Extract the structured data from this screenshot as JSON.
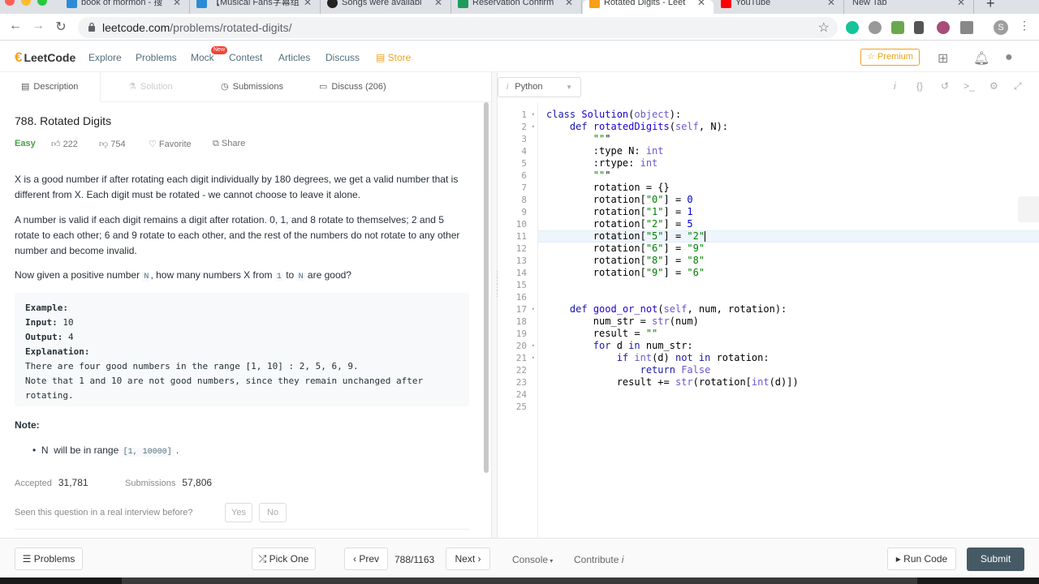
{
  "browser": {
    "tabs": [
      {
        "label": "book of mormon - 搜",
        "color": "#2c8bd6"
      },
      {
        "label": "【Musical Fans字幕组",
        "color": "#2c8bd6"
      },
      {
        "label": "Songs were availabl",
        "color": "#222222"
      },
      {
        "label": "Reservation Confirm",
        "color": "#1e9b5c"
      },
      {
        "label": "Rotated Digits - Leet",
        "color": "#f89f1b"
      },
      {
        "label": "YouTube",
        "color": "#ff0000"
      },
      {
        "label": "New Tab",
        "color": "#dee1e6"
      }
    ],
    "url_host": "leetcode.com",
    "url_path": "/problems/rotated-digits/",
    "profile_initial": "S"
  },
  "nav": {
    "logo": "LeetCode",
    "links": [
      "Explore",
      "Problems",
      "Mock",
      "Contest",
      "Articles",
      "Discuss"
    ],
    "store": "Store",
    "new_badge": "New",
    "premium": "Premium"
  },
  "left_tabs": [
    "Description",
    "Solution",
    "Submissions",
    "Discuss (206)"
  ],
  "problem": {
    "title": "788. Rotated Digits",
    "difficulty": "Easy",
    "likes": "222",
    "dislikes": "754",
    "favorite": "Favorite",
    "share": "Share",
    "p1": "X is a good number if after rotating each digit individually by 180 degrees, we get a valid number that is different from X.  Each digit must be rotated - we cannot choose to leave it alone.",
    "p2": "A number is valid if each digit remains a digit after rotation. 0, 1, and 8 rotate to themselves; 2 and 5 rotate to each other; 6 and 9 rotate to each other, and the rest of the numbers do not rotate to any other number and become invalid.",
    "p3_a": "Now given a positive number",
    "p3_n1": "N",
    "p3_b": ", how many numbers X from",
    "p3_one": "1",
    "p3_to": "to",
    "p3_n2": "N",
    "p3_c": "are good?",
    "example": {
      "head": "Example:",
      "input_label": "Input:",
      "input": "10",
      "output_label": "Output:",
      "output": "4",
      "expl_label": "Explanation:",
      "expl1": "There are four good numbers in the range [1, 10] : 2, 5, 6, 9.",
      "expl2": "Note that 1 and 10 are not good numbers, since they remain unchanged after",
      "expl3": "rotating."
    },
    "note_head": "Note:",
    "note_n": "N",
    "note_text": "will be in range",
    "note_range": "[1, 10000]",
    "note_end": ".",
    "accepted_label": "Accepted",
    "accepted": "31,781",
    "submissions_label": "Submissions",
    "submissions": "57,806",
    "seen": "Seen this question in a real interview before?",
    "yes": "Yes",
    "no": "No"
  },
  "editor": {
    "language": "Python",
    "line_numbers": [
      "1",
      "2",
      "3",
      "4",
      "5",
      "6",
      "7",
      "8",
      "9",
      "10",
      "11",
      "12",
      "13",
      "14",
      "15",
      "16",
      "17",
      "18",
      "19",
      "20",
      "21",
      "22",
      "23",
      "24",
      "25"
    ],
    "lines": [
      "class Solution(object):",
      "    def rotatedDigits(self, N):",
      "        \"\"\"",
      "        :type N: int",
      "        :rtype: int",
      "        \"\"\"",
      "        rotation = {}",
      "        rotation[\"0\"] = 0",
      "        rotation[\"1\"] = 1",
      "        rotation[\"2\"] = 5",
      "        rotation[\"5\"] = \"2\"",
      "        rotation[\"6\"] = \"9\"",
      "        rotation[\"8\"] = \"8\"",
      "        rotation[\"9\"] = \"6\"",
      "",
      "",
      "    def good_or_not(self, num, rotation):",
      "        num_str = str(num)",
      "        result = \"\"",
      "        for d in num_str:",
      "            if int(d) not in rotation:",
      "                return False",
      "            result += str(rotation[int(d)])",
      "",
      ""
    ],
    "active_line": "11"
  },
  "bottom": {
    "problems": "Problems",
    "pick_one": "Pick One",
    "prev": "Prev",
    "page": "788/1163",
    "next": "Next",
    "console": "Console",
    "contribute": "Contribute",
    "run_code": "Run Code",
    "submit": "Submit"
  }
}
